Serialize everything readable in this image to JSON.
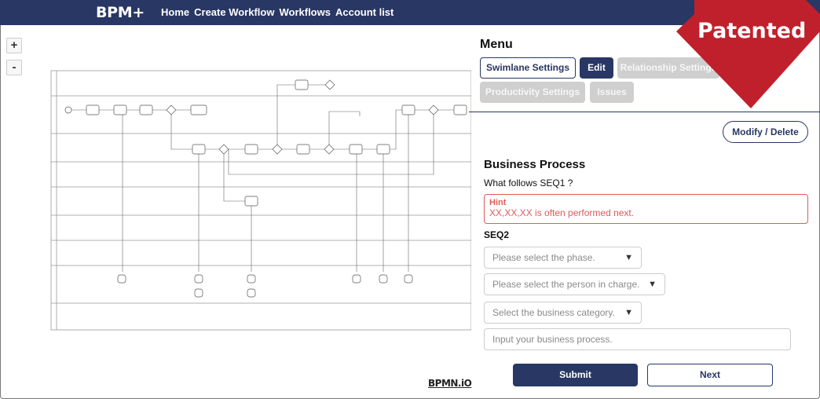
{
  "app": {
    "brand": "BPM+",
    "nav": [
      "Home",
      "Create Workflow",
      "Workflows",
      "Account list"
    ]
  },
  "canvas": {
    "zoom_in": "+",
    "zoom_out": "-",
    "bpmn_logo": "BPMN.iO"
  },
  "menu": {
    "title": "Menu",
    "tabs": [
      {
        "label": "Swimlane Settings",
        "state": "outline"
      },
      {
        "label": "Edit",
        "state": "active"
      },
      {
        "label": "Relationship Settings",
        "state": "disabled"
      },
      {
        "label": "Productivity Settings",
        "state": "disabled"
      },
      {
        "label": "Issues",
        "state": "disabled"
      }
    ]
  },
  "form": {
    "modify_delete": "Modify / Delete",
    "section_title": "Business Process",
    "question": "What follows SEQ1 ?",
    "hint_title": "Hint",
    "hint_text": "XX,XX,XX is often performed next.",
    "seq_label": "SEQ2",
    "phase_placeholder": "Please select the phase.",
    "person_placeholder": "Please select the person in charge.",
    "category_placeholder": "Select the business category.",
    "process_placeholder": "Input your business process.",
    "submit": "Submit",
    "next": "Next"
  },
  "badge": {
    "text": "Patented",
    "color": "#c0202c"
  },
  "colors": {
    "primary": "#283763",
    "hint": "#e05a5a",
    "disabled": "#cfcfcf"
  }
}
